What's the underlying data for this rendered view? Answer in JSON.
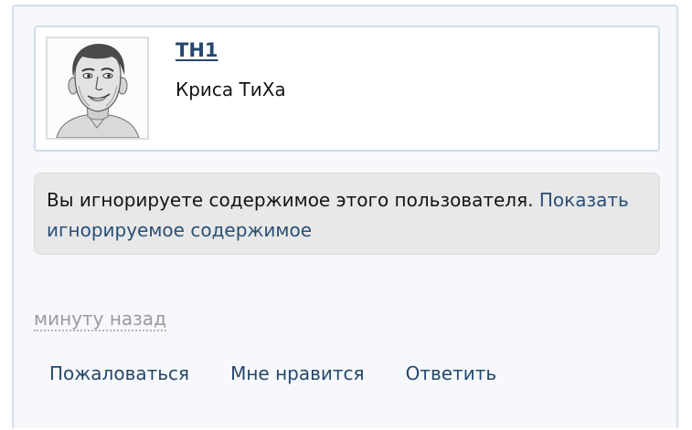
{
  "post": {
    "author": {
      "username": "TH1",
      "title": "Криса ТиХа",
      "avatar_icon": "avatar-sketch-portrait"
    },
    "ignored_notice": {
      "text": "Вы игнорируете содержимое этого пользователя.",
      "show_link": "Показать игнорируемое содержимое"
    },
    "timestamp": "минуту назад",
    "actions": {
      "report": "Пожаловаться",
      "like": "Мне нравится",
      "reply": "Ответить"
    }
  },
  "colors": {
    "link": "#25476c",
    "card_border": "#cfdcec",
    "notice_bg": "#e8e8e8",
    "muted": "#9a9a9a"
  }
}
